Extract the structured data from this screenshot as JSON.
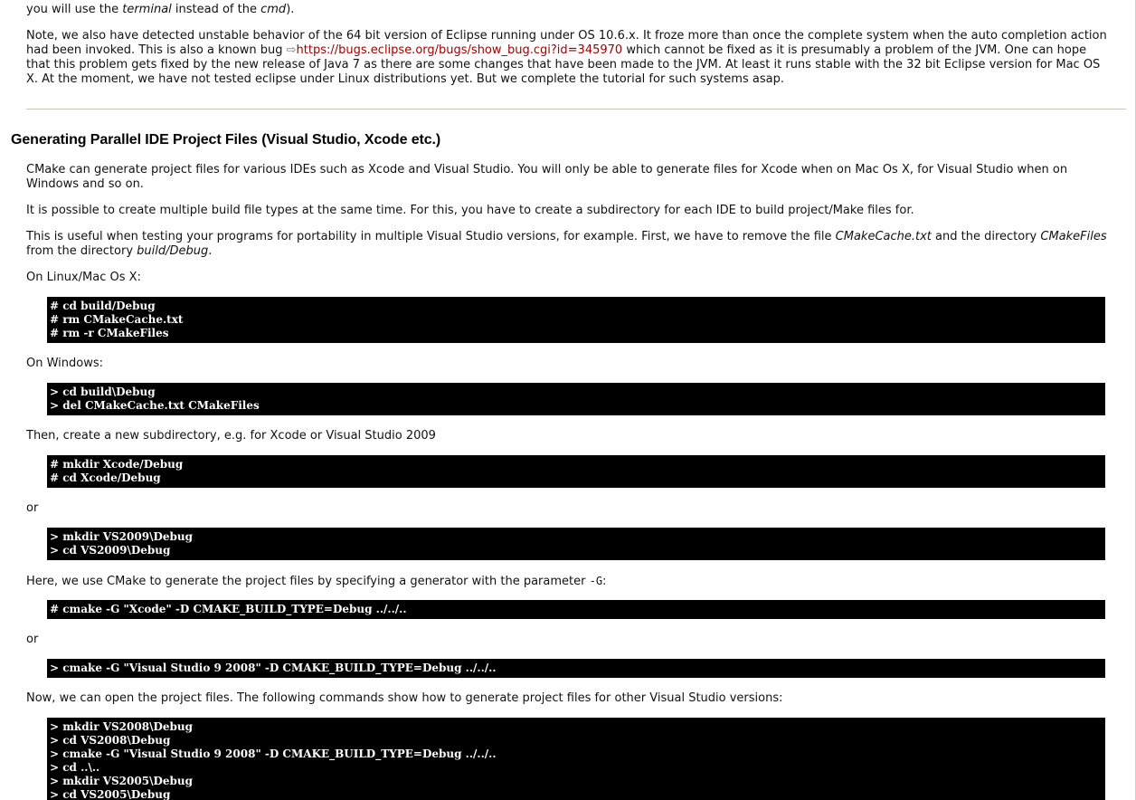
{
  "intro": {
    "line1_pre": "you will use the ",
    "line1_em1": "terminal",
    "line1_mid": " instead of the ",
    "line1_em2": "cmd",
    "line1_post": ").",
    "note_pre": "Note, we also have detected unstable behavior of the 64 bit version of Eclipse running under OS 10.6.x. It froze more than once the complete system when the auto completion action had been invoked. This is also a known bug ",
    "note_arrow": "⇨",
    "note_link": "https://bugs.eclipse.org/bugs/show_bug.cgi?id=345970",
    "note_post": " which cannot be fixed as it is presumably a problem of the JVM. One can hope that this problem gets fixed by the new release of Java 7 as there are some changes that have been made to the JVM. At least it runs stable with the 32 bit Eclipse version for Mac OS X. At the moment, we have not tested eclipse under Linux distributions yet. But we complete the tutorial for such systems asap."
  },
  "section": {
    "title": "Generating Parallel IDE Project Files (Visual Studio, Xcode etc.)",
    "p1": "CMake can generate project files for various IDEs such as Xcode and Visual Studio. You will only be able to generate files for Xcode when on Mac Os X, for Visual Studio when on Windows and so on.",
    "p2": "It is possible to create multiple build file types at the same time. For this, you have to create a subdirectory for each IDE to build project/Make files for.",
    "p3_pre": "This is useful when testing your programs for portability in multiple Visual Studio versions, for example. First, we have to remove the file ",
    "p3_em1": "CMakeCache.txt",
    "p3_mid": " and the directory ",
    "p3_em2": "CMakeFiles",
    "p3_mid2": " from the directory ",
    "p3_em3": "build/Debug",
    "p3_post": ".",
    "linux_label": "On Linux/Mac Os X:",
    "code_linux": "# cd build/Debug\n# rm CMakeCache.txt\n# rm -r CMakeFiles",
    "windows_label": "On Windows:",
    "code_windows": "> cd build\\Debug\n> del CMakeCache.txt CMakeFiles",
    "then_label": "Then, create a new subdirectory, e.g. for Xcode or Visual Studio 2009",
    "code_xcode_dir": "# mkdir Xcode/Debug\n# cd Xcode/Debug",
    "or1": "or",
    "code_vs_dir": "> mkdir VS2009\\Debug\n> cd VS2009\\Debug",
    "here_pre": "Here, we use CMake to generate the project files by specifying a generator with the parameter ",
    "here_code": "-G",
    "here_post": ":",
    "code_cmake_xcode": "# cmake -G \"Xcode\" -D CMAKE_BUILD_TYPE=Debug ../../..",
    "or2": "or",
    "code_cmake_vs": "> cmake -G \"Visual Studio 9 2008\" -D CMAKE_BUILD_TYPE=Debug ../../..",
    "now_label": "Now, we can open the project files. The following commands show how to generate project files for other Visual Studio versions:",
    "code_other_vs": "> mkdir VS2008\\Debug\n> cd VS2008\\Debug\n> cmake -G \"Visual Studio 9 2008\" -D CMAKE_BUILD_TYPE=Debug ../../..\n> cd ..\\..\n> mkdir VS2005\\Debug\n> cd VS2005\\Debug"
  }
}
